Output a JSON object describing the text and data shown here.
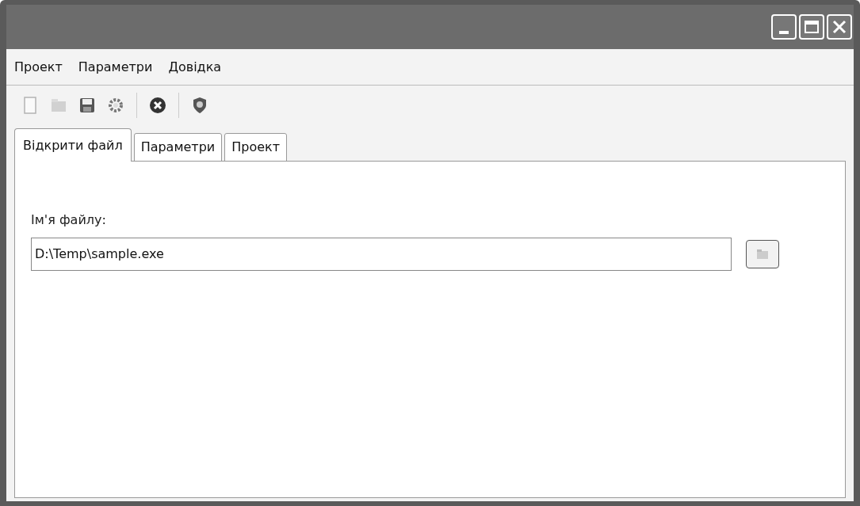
{
  "menu": [
    "Проект",
    "Параметри",
    "Довідка"
  ],
  "toolbar": {
    "groups": [
      [
        {
          "kind": "new",
          "disabled": true
        },
        {
          "kind": "open",
          "disabled": true
        },
        {
          "kind": "save",
          "disabled": false
        },
        {
          "kind": "settings",
          "disabled": false
        }
      ],
      [
        {
          "kind": "stop",
          "disabled": false
        }
      ],
      [
        {
          "kind": "help",
          "disabled": false
        }
      ]
    ]
  },
  "tabs": [
    {
      "label": "Відкрити файл",
      "selected": true
    },
    {
      "label": "Параметри",
      "selected": false
    },
    {
      "label": "Проект",
      "selected": false
    }
  ],
  "form": {
    "label": "Ім'я файлу:",
    "value": "D:\\Temp\\sample.exe"
  }
}
